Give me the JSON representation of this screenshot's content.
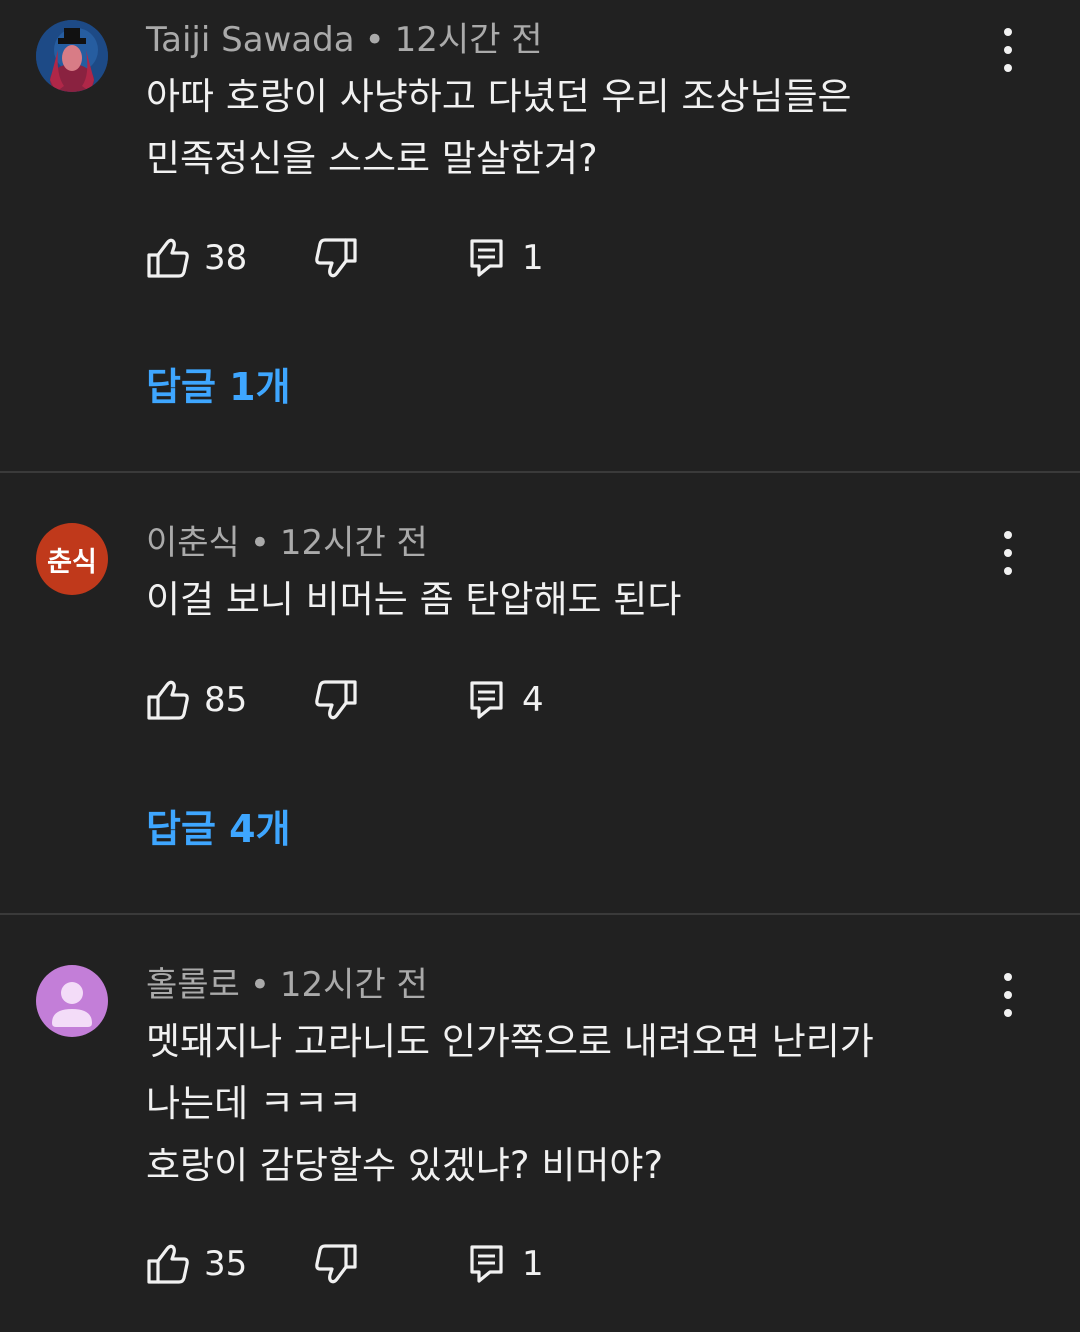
{
  "comments": [
    {
      "author": "Taiji Sawada",
      "time": "12시간 전",
      "text": "아따 호랑이 사냥하고 다녔던 우리 조상님들은\n민족정신을 스스로 말살한겨?",
      "likes": "38",
      "reply_count_label": "1",
      "replies_link": "답글 1개",
      "avatar_text": ""
    },
    {
      "author": "이춘식",
      "time": "12시간 전",
      "text": "이걸 보니 비머는 좀 탄압해도 된다",
      "likes": "85",
      "reply_count_label": "4",
      "replies_link": "답글 4개",
      "avatar_text": "춘식"
    },
    {
      "author": "홀롤로",
      "time": "12시간 전",
      "text": "멧돼지나 고라니도 인가쪽으로 내려오면 난리가\n나는데 ㅋㅋㅋ\n호랑이 감당할수 있겠냐? 비머야?",
      "likes": "35",
      "reply_count_label": "1",
      "avatar_text": ""
    }
  ],
  "colors": {
    "background": "#212121",
    "link": "#3ea6ff",
    "meta": "#aaaaaa",
    "avatar2": "#c0391b",
    "avatar3": "#c37ed8"
  },
  "icons": [
    "like-icon",
    "dislike-icon",
    "reply-icon",
    "more-vert-icon",
    "person-icon"
  ]
}
